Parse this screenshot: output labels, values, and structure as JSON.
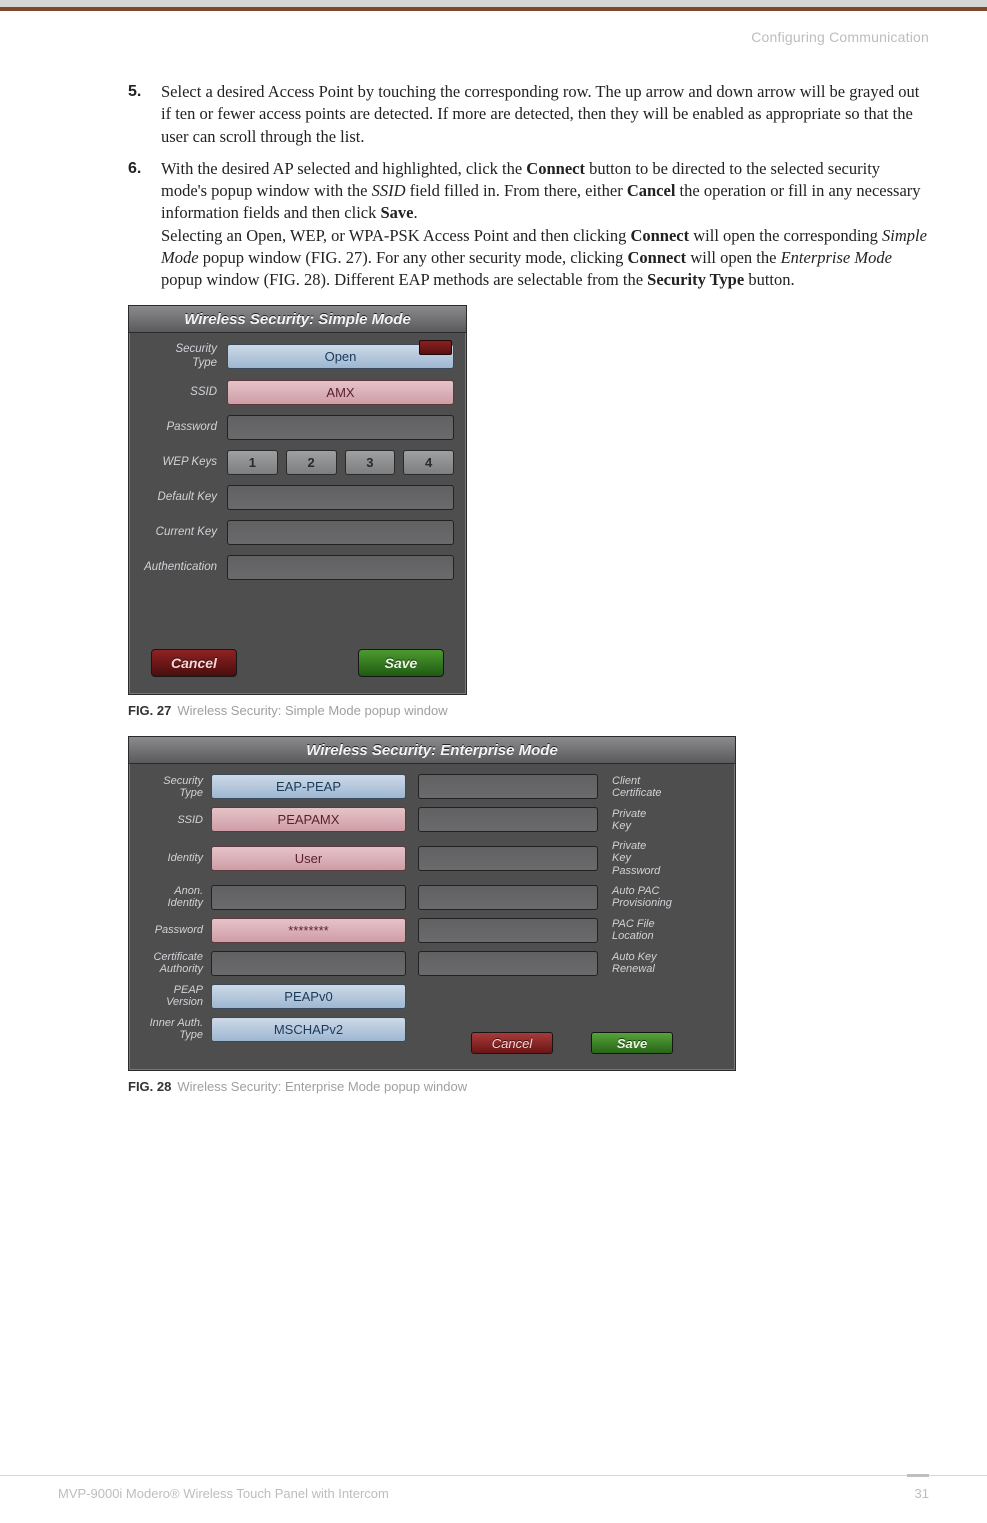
{
  "header": {
    "section": "Configuring Communication"
  },
  "steps": {
    "s5": "Select a desired Access Point by touching the corresponding row. The up arrow and down arrow will be grayed out if ten or fewer access points are detected. If more are detected, then they will be enabled as appropriate so that the user can scroll through the list.",
    "s6a": "With the desired AP selected and highlighted, click the ",
    "s6_connect": "Connect",
    "s6b": " button to be directed to the selected security mode's popup window with the ",
    "s6_ssid": "SSID",
    "s6c": " field filled in. From there, either ",
    "s6_cancel": "Cancel",
    "s6d": " the operation or fill in any necessary information fields and then click ",
    "s6_save": "Save",
    "s6e": ".",
    "s6f": "Selecting an Open, WEP, or WPA-PSK Access Point and then clicking ",
    "s6g": " will open the corresponding ",
    "s6_sm": "Simple Mode",
    "s6h": " popup window (FIG. 27). For any other security mode, clicking ",
    "s6i": " will open the ",
    "s6_em": "Enterprise Mode",
    "s6j": " popup window (FIG. 28). Different EAP methods are selectable from the ",
    "s6_st": "Security Type",
    "s6k": " button."
  },
  "fig27": {
    "title": "Wireless Security: Simple Mode",
    "labels": {
      "sectype": "Security\nType",
      "ssid": "SSID",
      "password": "Password",
      "wepkeys": "WEP Keys",
      "defaultkey": "Default Key",
      "currentkey": "Current Key",
      "auth": "Authentication"
    },
    "values": {
      "sectype": "Open",
      "ssid": "AMX",
      "wep": [
        "1",
        "2",
        "3",
        "4"
      ]
    },
    "buttons": {
      "cancel": "Cancel",
      "save": "Save"
    },
    "caption_tag": "FIG. 27",
    "caption": "Wireless Security: Simple Mode popup window"
  },
  "fig28": {
    "title": "Wireless Security: Enterprise Mode",
    "left_labels": [
      "Security\nType",
      "SSID",
      "Identity",
      "Anon.\nIdentity",
      "Password",
      "Certificate\nAuthority",
      "PEAP\nVersion",
      "Inner Auth.\nType"
    ],
    "right_labels": [
      "Client\nCertificate",
      "Private\nKey",
      "Private\nKey\nPassword",
      "Auto PAC\nProvisioning",
      "PAC File\nLocation",
      "Auto Key\nRenewal"
    ],
    "values": {
      "sectype": "EAP-PEAP",
      "ssid": "PEAPAMX",
      "identity": "User",
      "anon": "",
      "password": "********",
      "cert": "",
      "peapver": "PEAPv0",
      "innerauth": "MSCHAPv2"
    },
    "buttons": {
      "cancel": "Cancel",
      "save": "Save"
    },
    "caption_tag": "FIG. 28",
    "caption": "Wireless Security: Enterprise Mode popup window"
  },
  "footer": {
    "left": "MVP-9000i Modero® Wireless Touch Panel with Intercom",
    "right": "31"
  }
}
